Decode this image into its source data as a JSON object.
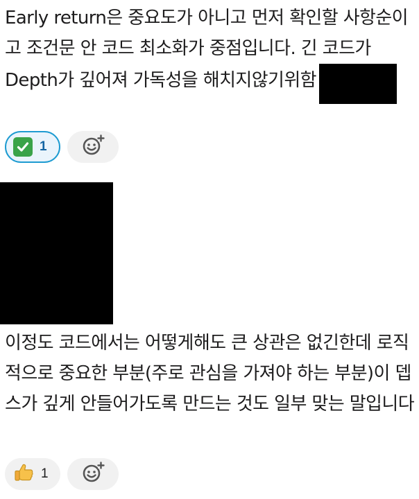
{
  "message1": {
    "text": "Early return은 중요도가 아니고 먼저 확인할 사항순이고 조건문 안 코드 최소화가 중점입니다. 긴 코드가 Depth가 깊어져 가독성을 해치지않기위함",
    "reactions": [
      {
        "icon": "white-check-mark-icon",
        "count": "1",
        "active": true
      }
    ]
  },
  "message2": {
    "text": "이정도 코드에서는 어떻게해도 큰 상관은 없긴한데 로직적으로 중요한 부분(주로 관심을 가져야 하는 부분)이 뎁스가 깊게 안들어가도록 만드는 것도 일부 맞는 말입니다",
    "reactions": [
      {
        "icon": "thumbs-up-icon",
        "count": "1",
        "active": false
      }
    ]
  },
  "colors": {
    "active_border": "#1d9bd1",
    "active_bg": "#eaf4fc",
    "pill_bg": "#f1f1f1",
    "text": "#1d1c1d",
    "check_green": "#3aa349"
  }
}
